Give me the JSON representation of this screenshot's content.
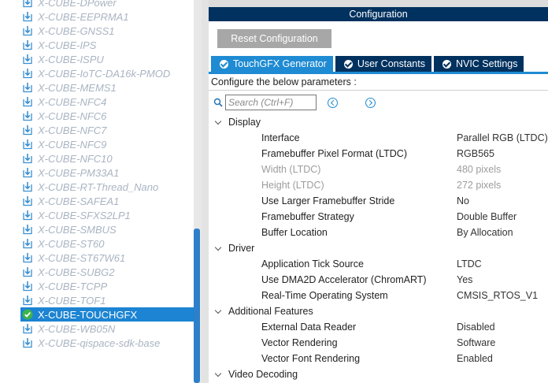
{
  "packages": [
    {
      "label": "X-CUBE-DPower",
      "selected": false
    },
    {
      "label": "X-CUBE-EEPRMA1",
      "selected": false
    },
    {
      "label": "X-CUBE-GNSS1",
      "selected": false
    },
    {
      "label": "X-CUBE-IPS",
      "selected": false
    },
    {
      "label": "X-CUBE-ISPU",
      "selected": false
    },
    {
      "label": "X-CUBE-IoTC-DA16k-PMOD",
      "selected": false
    },
    {
      "label": "X-CUBE-MEMS1",
      "selected": false
    },
    {
      "label": "X-CUBE-NFC4",
      "selected": false
    },
    {
      "label": "X-CUBE-NFC6",
      "selected": false
    },
    {
      "label": "X-CUBE-NFC7",
      "selected": false
    },
    {
      "label": "X-CUBE-NFC9",
      "selected": false
    },
    {
      "label": "X-CUBE-NFC10",
      "selected": false
    },
    {
      "label": "X-CUBE-PM33A1",
      "selected": false
    },
    {
      "label": "X-CUBE-RT-Thread_Nano",
      "selected": false
    },
    {
      "label": "X-CUBE-SAFEA1",
      "selected": false
    },
    {
      "label": "X-CUBE-SFXS2LP1",
      "selected": false
    },
    {
      "label": "X-CUBE-SMBUS",
      "selected": false
    },
    {
      "label": "X-CUBE-ST60",
      "selected": false
    },
    {
      "label": "X-CUBE-ST67W61",
      "selected": false
    },
    {
      "label": "X-CUBE-SUBG2",
      "selected": false
    },
    {
      "label": "X-CUBE-TCPP",
      "selected": false
    },
    {
      "label": "X-CUBE-TOF1",
      "selected": false
    },
    {
      "label": "X-CUBE-TOUCHGFX",
      "selected": true
    },
    {
      "label": "X-CUBE-WB05N",
      "selected": false
    },
    {
      "label": "X-CUBE-qispace-sdk-base",
      "selected": false
    }
  ],
  "config": {
    "header": "Configuration",
    "reset_label": "Reset Configuration",
    "tabs": [
      {
        "label": "TouchGFX Generator",
        "active": true
      },
      {
        "label": "User Constants",
        "active": false
      },
      {
        "label": "NVIC Settings",
        "active": false
      }
    ],
    "intro": "Configure the below parameters :",
    "search_placeholder": "Search (Ctrl+F)",
    "groups": [
      {
        "label": "Display",
        "params": [
          {
            "name": "Interface",
            "value": "Parallel RGB (LTDC)",
            "disabled": false
          },
          {
            "name": "Framebuffer Pixel Format (LTDC)",
            "value": "RGB565",
            "disabled": false
          },
          {
            "name": "Width (LTDC)",
            "value": "480 pixels",
            "disabled": true
          },
          {
            "name": "Height (LTDC)",
            "value": "272 pixels",
            "disabled": true
          },
          {
            "name": "Use Larger Framebuffer Stride",
            "value": "No",
            "disabled": false
          },
          {
            "name": "Framebuffer Strategy",
            "value": "Double Buffer",
            "disabled": false
          },
          {
            "name": "Buffer Location",
            "value": "By Allocation",
            "disabled": false
          }
        ]
      },
      {
        "label": "Driver",
        "params": [
          {
            "name": "Application Tick Source",
            "value": "LTDC",
            "disabled": false
          },
          {
            "name": "Use DMA2D Accelerator (ChromART)",
            "value": "Yes",
            "disabled": false
          },
          {
            "name": "Real-Time Operating System",
            "value": "CMSIS_RTOS_V1",
            "disabled": false
          }
        ]
      },
      {
        "label": "Additional Features",
        "params": [
          {
            "name": "External Data Reader",
            "value": "Disabled",
            "disabled": false
          },
          {
            "name": "Vector Rendering",
            "value": "Software",
            "disabled": false
          },
          {
            "name": "Vector Font Rendering",
            "value": "Enabled",
            "disabled": false
          }
        ]
      },
      {
        "label": "Video Decoding",
        "params": []
      }
    ]
  },
  "colors": {
    "header_bg": "#00315f",
    "tab_active": "#1e8bd3",
    "selected_item": "#1c84d2",
    "package_text": "#a9b4c2",
    "check_green": "#3cb44b"
  }
}
